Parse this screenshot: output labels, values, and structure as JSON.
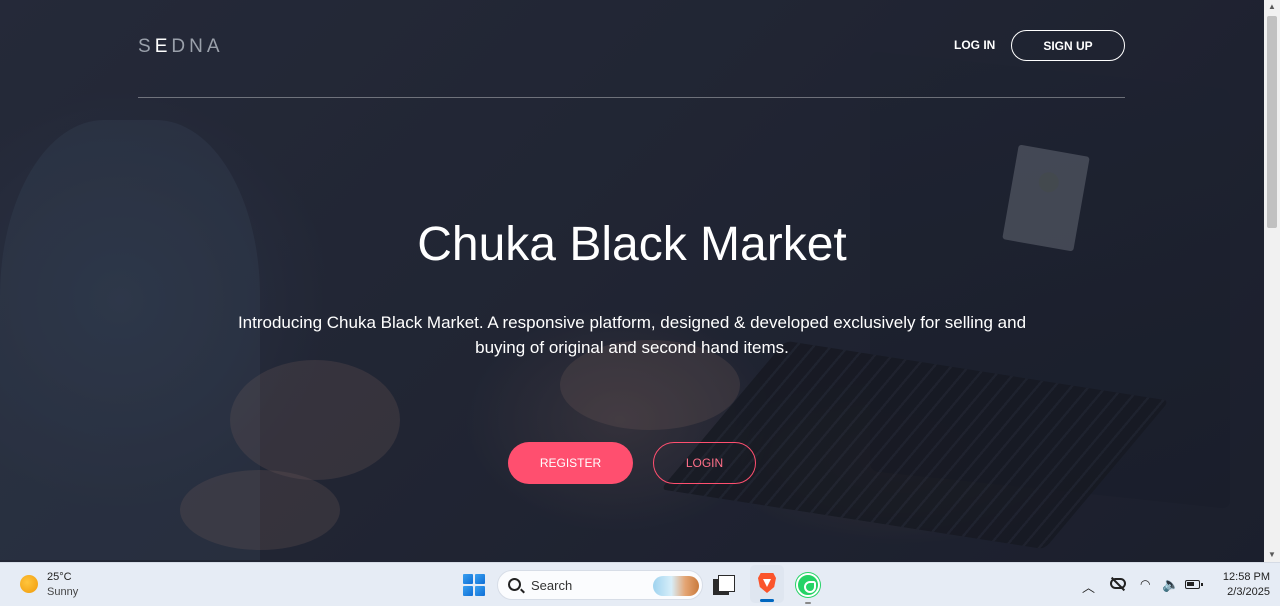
{
  "nav": {
    "logo_prefix": "S",
    "logo_highlight": "E",
    "logo_suffix": "DNA",
    "login_label": "LOG IN",
    "signup_label": "SIGN UP"
  },
  "hero": {
    "title": "Chuka Black Market",
    "subtitle": "Introducing Chuka Black Market. A responsive platform, designed & developed exclusively for selling and buying of original and second hand items.",
    "register_label": "REGISTER",
    "login_label": "LOGIN"
  },
  "colors": {
    "accent": "#ff4f6f",
    "overlay": "#262b3b"
  },
  "taskbar": {
    "weather": {
      "temp": "25°C",
      "condition": "Sunny",
      "icon": "sun-icon"
    },
    "search_placeholder": "Search",
    "apps": [
      "windows-start-icon",
      "file-explorer-icon",
      "brave-browser-icon",
      "whatsapp-icon"
    ],
    "clock": {
      "time": "12:58 PM",
      "date": "2/3/2025"
    }
  }
}
